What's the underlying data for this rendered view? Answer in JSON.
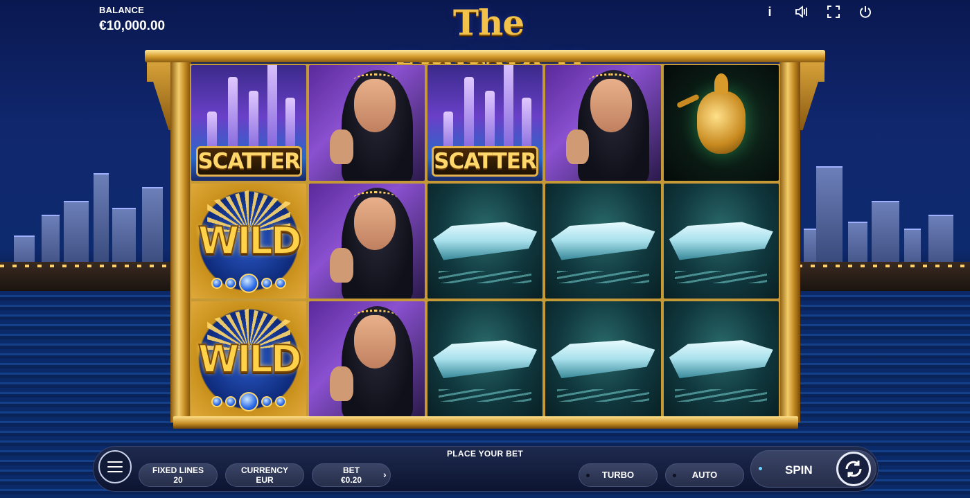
{
  "header": {
    "balance_label": "BALANCE",
    "balance_value": "€10,000.00",
    "game_title": "The Emirate II",
    "icons": [
      "info-icon",
      "sound-icon",
      "fullscreen-icon",
      "power-icon"
    ]
  },
  "reels": {
    "grid": [
      [
        "scatter",
        "lady",
        "scatter",
        "lady",
        "teapot"
      ],
      [
        "wild",
        "lady",
        "yacht",
        "yacht",
        "yacht"
      ],
      [
        "wild",
        "lady",
        "yacht",
        "yacht",
        "yacht"
      ]
    ],
    "scatter_label": "SCATTER",
    "wild_label": "WILD"
  },
  "controls": {
    "status_text": "PLACE YOUR BET",
    "fixed_lines_label": "FIXED LINES",
    "fixed_lines_value": "20",
    "currency_label": "CURRENCY",
    "currency_value": "EUR",
    "bet_label": "BET",
    "bet_value": "€0.20",
    "turbo_label": "TURBO",
    "auto_label": "AUTO",
    "spin_label": "SPIN"
  },
  "colors": {
    "gold": "#d49a2a",
    "night_blue": "#10276e",
    "panel": "#1e2a4e"
  }
}
